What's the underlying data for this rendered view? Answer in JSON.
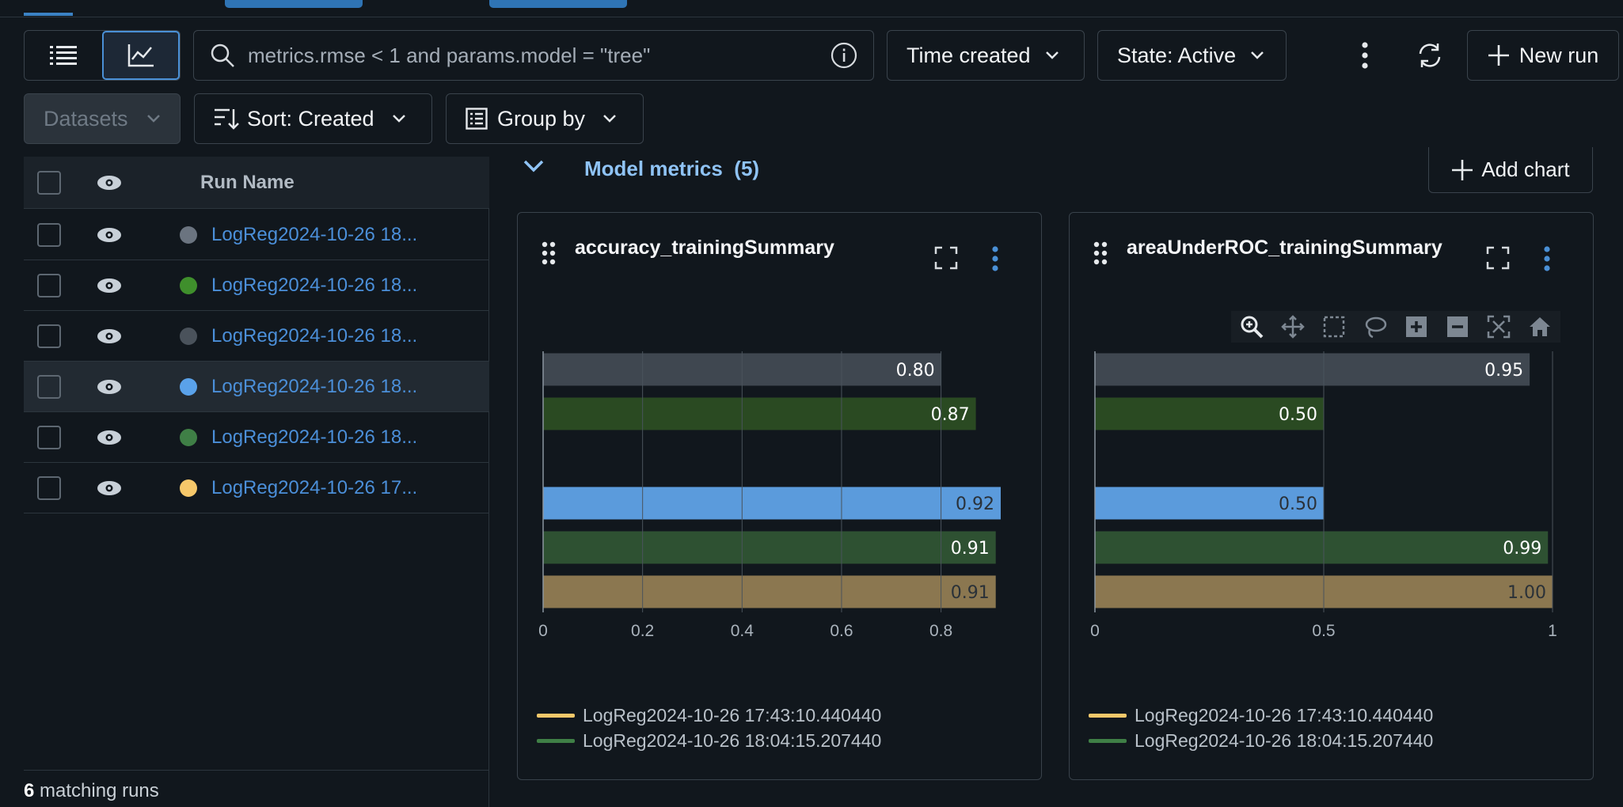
{
  "toolbar": {
    "search_placeholder": "metrics.rmse < 1 and params.model = \"tree\"",
    "time_created": "Time created",
    "state": "State: Active",
    "new_run": "New run",
    "datasets": "Datasets",
    "sort": "Sort: Created",
    "group_by": "Group by"
  },
  "table": {
    "header": "Run Name",
    "rows": [
      {
        "name": "LogReg2024-10-26 18...",
        "color": "#6b7480"
      },
      {
        "name": "LogReg2024-10-26 18...",
        "color": "#3f8f2c"
      },
      {
        "name": "LogReg2024-10-26 18...",
        "color": "#4a525b"
      },
      {
        "name": "LogReg2024-10-26 18...",
        "color": "#5aa2ea"
      },
      {
        "name": "LogReg2024-10-26 18...",
        "color": "#3f7f46"
      },
      {
        "name": "LogReg2024-10-26 17...",
        "color": "#f6c86a"
      }
    ],
    "footer_count": "6",
    "footer_text": " matching runs"
  },
  "section": {
    "title": "Model metrics",
    "count": "(5)",
    "add_chart": "Add chart"
  },
  "legend": [
    {
      "label": "LogReg2024-10-26 17:43:10.440440",
      "color": "#f6c86a"
    },
    {
      "label": "LogReg2024-10-26 18:04:15.207440",
      "color": "#3f7f46"
    }
  ],
  "chart_data": [
    {
      "type": "bar",
      "title": "accuracy_trainingSummary",
      "orientation": "horizontal",
      "xlim": [
        0,
        0.92
      ],
      "ticks": [
        "0",
        "0.2",
        "0.4",
        "0.6",
        "0.8"
      ],
      "tick_values": [
        0,
        0.2,
        0.4,
        0.6,
        0.8
      ],
      "bars": [
        {
          "value": 0.8,
          "label": "0.80",
          "color": "#3f4750"
        },
        {
          "value": 0.87,
          "label": "0.87",
          "color": "#2a4a22"
        },
        {
          "value": 0.92,
          "label": "0.92",
          "color": "#5b9bdc"
        },
        {
          "value": 0.91,
          "label": "0.91",
          "color": "#2e5132"
        },
        {
          "value": 0.91,
          "label": "0.91",
          "color": "#8b7750"
        }
      ]
    },
    {
      "type": "bar",
      "title": "areaUnderROC_trainingSummary",
      "orientation": "horizontal",
      "xlim": [
        0,
        1
      ],
      "ticks": [
        "0",
        "0.5",
        "1"
      ],
      "tick_values": [
        0,
        0.5,
        1
      ],
      "bars": [
        {
          "value": 0.95,
          "label": "0.95",
          "color": "#3f4750"
        },
        {
          "value": 0.5,
          "label": "0.50",
          "color": "#2a4a22"
        },
        {
          "value": 0.5,
          "label": "0.50",
          "color": "#5b9bdc"
        },
        {
          "value": 0.99,
          "label": "0.99",
          "color": "#2e5132"
        },
        {
          "value": 1.0,
          "label": "1.00",
          "color": "#8b7750"
        }
      ]
    }
  ]
}
